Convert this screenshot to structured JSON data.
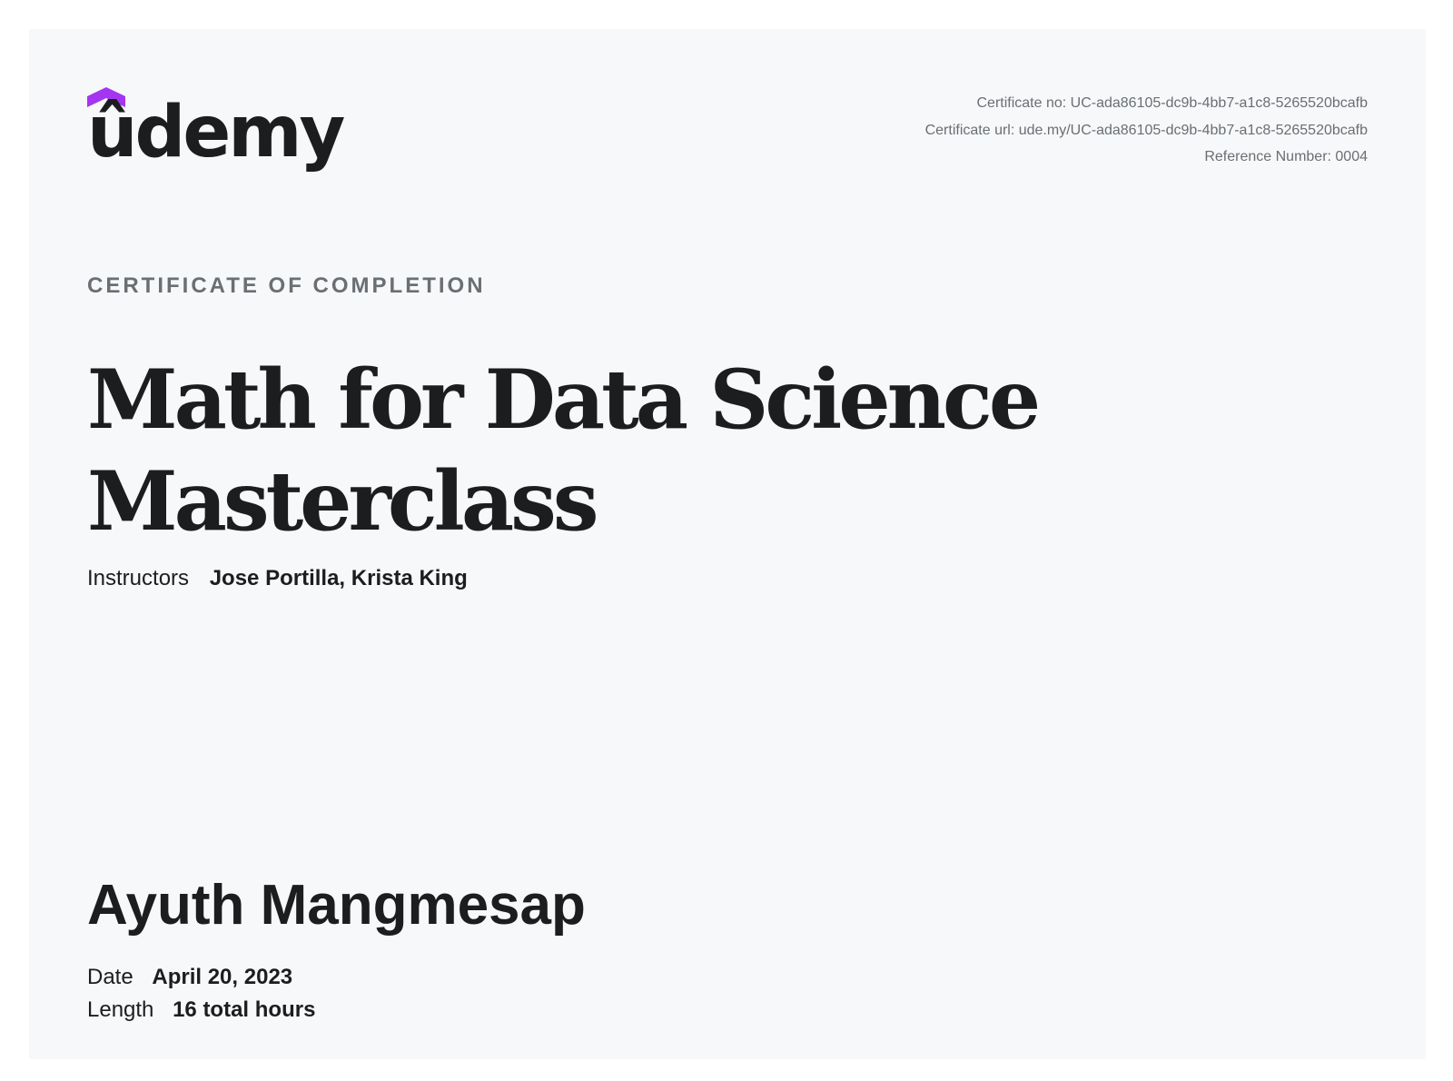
{
  "brand": {
    "logo_text": "ûdemy",
    "accent_color": "#a435f0"
  },
  "meta": {
    "certificate_no": "Certificate no: UC-ada86105-dc9b-4bb7-a1c8-5265520bcafb",
    "certificate_url": "Certificate url: ude.my/UC-ada86105-dc9b-4bb7-a1c8-5265520bcafb",
    "reference_number": "Reference Number: 0004"
  },
  "certificate": {
    "eyebrow": "CERTIFICATE OF COMPLETION",
    "course_title": "Math for Data Science Masterclass",
    "instructors_label": "Instructors",
    "instructors": [
      "Jose Portilla,",
      "Krista King"
    ],
    "recipient_name": "Ayuth Mangmesap",
    "date_label": "Date",
    "date_value": "April 20, 2023",
    "length_label": "Length",
    "length_value": "16 total hours"
  }
}
